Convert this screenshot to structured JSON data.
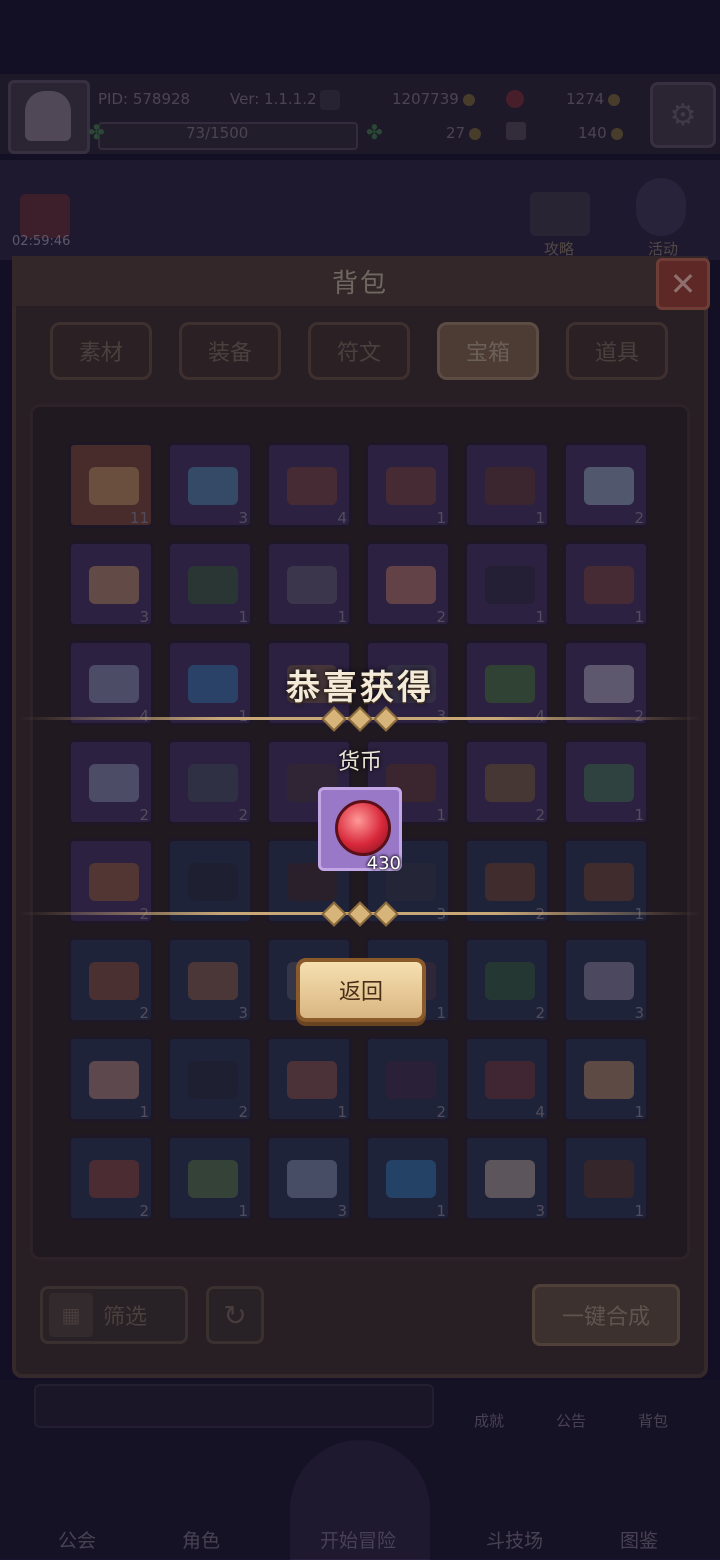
{
  "status": {
    "pid": "PID: 578928",
    "version": "Ver: 1.1.1.2",
    "gold": "1207739",
    "gems": "1274",
    "xp": "73/1500",
    "clover": "27",
    "keys": "140"
  },
  "scene": {
    "timer": "02:59:46",
    "guide": "攻略",
    "event": "活动"
  },
  "bag": {
    "title": "背包",
    "close_icon": "close-icon",
    "tabs": [
      "素材",
      "装备",
      "符文",
      "宝箱",
      "道具"
    ],
    "active_tab": "宝箱",
    "filter_label": "筛选",
    "merge_label": "一键合成"
  },
  "slots": [
    {
      "c": "11",
      "k": "o",
      "col": "#c8a070"
    },
    {
      "c": "3",
      "k": "p",
      "col": "#5aa0c8"
    },
    {
      "c": "4",
      "k": "p",
      "col": "#8a4a3a"
    },
    {
      "c": "1",
      "k": "p",
      "col": "#8a4a3a"
    },
    {
      "c": "1",
      "k": "p",
      "col": "#6a3a2a"
    },
    {
      "c": "2",
      "k": "p",
      "col": "#a8c8d8"
    },
    {
      "c": "3",
      "k": "p",
      "col": "#d8a070"
    },
    {
      "c": "1",
      "k": "p",
      "col": "#3a6a3a"
    },
    {
      "c": "1",
      "k": "p",
      "col": "#6a6a7a"
    },
    {
      "c": "2",
      "k": "p",
      "col": "#d88a70"
    },
    {
      "c": "1",
      "k": "p",
      "col": "#2a2a3a"
    },
    {
      "c": "1",
      "k": "p",
      "col": "#8a4a3a"
    },
    {
      "c": "4",
      "k": "p",
      "col": "#9aa8c8"
    },
    {
      "c": "1",
      "k": "p",
      "col": "#3a8ac8"
    },
    {
      "c": "",
      "k": "p",
      "col": "#8a6a4a"
    },
    {
      "c": "3",
      "k": "p",
      "col": "#5a5a6a"
    },
    {
      "c": "4",
      "k": "p",
      "col": "#4a8a3a"
    },
    {
      "c": "2",
      "k": "p",
      "col": "#c8c8d8"
    },
    {
      "c": "2",
      "k": "p",
      "col": "#9aa8c8"
    },
    {
      "c": "2",
      "k": "p",
      "col": "#4a5a6a"
    },
    {
      "c": "",
      "k": "p",
      "col": "#4a3a3a"
    },
    {
      "c": "1",
      "k": "p",
      "col": "#6a3a2a"
    },
    {
      "c": "2",
      "k": "p",
      "col": "#8a6a3a"
    },
    {
      "c": "1",
      "k": "p",
      "col": "#4a8a5a"
    },
    {
      "c": "2",
      "k": "p",
      "col": "#a86a3a"
    },
    {
      "c": "",
      "k": "b",
      "col": "#2a2a3a"
    },
    {
      "c": "",
      "k": "b",
      "col": "#4a2a2a"
    },
    {
      "c": "3",
      "k": "b",
      "col": "#3a3a4a"
    },
    {
      "c": "2",
      "k": "b",
      "col": "#8a4a2a"
    },
    {
      "c": "1",
      "k": "b",
      "col": "#8a4a2a"
    },
    {
      "c": "2",
      "k": "b",
      "col": "#a8583a"
    },
    {
      "c": "3",
      "k": "b",
      "col": "#a86a4a"
    },
    {
      "c": "",
      "k": "b",
      "col": "#6a6a7a"
    },
    {
      "c": "1",
      "k": "b",
      "col": "#5a3a4a"
    },
    {
      "c": "2",
      "k": "b",
      "col": "#3a6a3a"
    },
    {
      "c": "3",
      "k": "b",
      "col": "#a89ab8"
    },
    {
      "c": "1",
      "k": "b",
      "col": "#d89a88"
    },
    {
      "c": "2",
      "k": "b",
      "col": "#2a2a3a"
    },
    {
      "c": "1",
      "k": "b",
      "col": "#a85a4a"
    },
    {
      "c": "2",
      "k": "b",
      "col": "#4a2a4a"
    },
    {
      "c": "4",
      "k": "b",
      "col": "#8a3a3a"
    },
    {
      "c": "1",
      "k": "b",
      "col": "#d8a070"
    },
    {
      "c": "2",
      "k": "b",
      "col": "#a84a3a"
    },
    {
      "c": "1",
      "k": "b",
      "col": "#6a8a4a"
    },
    {
      "c": "3",
      "k": "b",
      "col": "#9aa8c8"
    },
    {
      "c": "1",
      "k": "b",
      "col": "#3a8ac8"
    },
    {
      "c": "3",
      "k": "b",
      "col": "#d8c0b0"
    },
    {
      "c": "1",
      "k": "b",
      "col": "#6a3a2a"
    }
  ],
  "nav": {
    "items": [
      "公会",
      "角色",
      "开始冒险",
      "斗技场",
      "图鉴"
    ],
    "mini": [
      "成就",
      "公告",
      "背包"
    ]
  },
  "popup": {
    "title": "恭喜获得",
    "subtitle": "货币",
    "reward_icon": "ruby-gem-icon",
    "reward_count": "430",
    "back_label": "返回"
  }
}
